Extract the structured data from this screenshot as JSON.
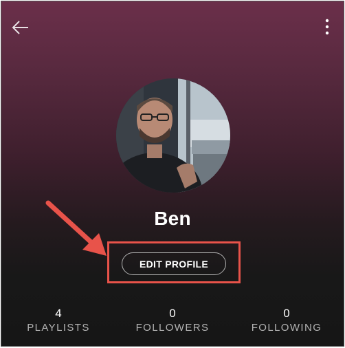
{
  "profile": {
    "name": "Ben",
    "edit_label": "EDIT PROFILE"
  },
  "stats": [
    {
      "count": "4",
      "label": "PLAYLISTS"
    },
    {
      "count": "0",
      "label": "FOLLOWERS"
    },
    {
      "count": "0",
      "label": "FOLLOWING"
    }
  ],
  "colors": {
    "header_gradient_top": "#6b2f4a",
    "background": "#161616",
    "annotation_red": "#e8534a"
  },
  "icons": {
    "back": "arrow-left-icon",
    "more": "more-vertical-icon"
  }
}
